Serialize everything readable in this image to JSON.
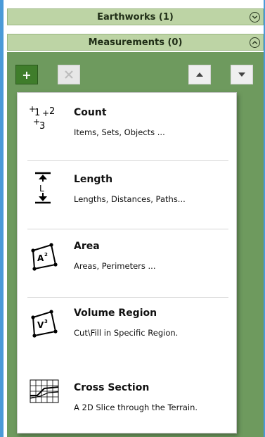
{
  "sections": {
    "earthworks": {
      "label": "Earthworks (1)",
      "state": "collapsed"
    },
    "measurements": {
      "label": "Measurements (0)",
      "state": "expanded"
    }
  },
  "toolbar": {
    "add_label": "+",
    "delete_icon": "close-icon",
    "up_icon": "arrow-up-icon",
    "down_icon": "arrow-down-icon"
  },
  "menu": {
    "items": [
      {
        "title": "Count",
        "desc": "Items, Sets, Objects ...",
        "icon": "count-icon",
        "glyphs": {
          "a": "+",
          "a_sub": "1",
          "b": "+",
          "b_sub": "2",
          "c": "+",
          "c_sub": "3"
        }
      },
      {
        "title": "Length",
        "desc": "Lengths, Distances, Paths...",
        "icon": "length-icon",
        "glyph": "L"
      },
      {
        "title": "Area",
        "desc": "Areas, Perimeters ...",
        "icon": "area-icon",
        "glyph": "A",
        "glyph_sup": "2"
      },
      {
        "title": "Volume Region",
        "desc": "Cut\\Fill in Specific Region.",
        "icon": "volume-icon",
        "glyph": "V",
        "glyph_sup": "3"
      },
      {
        "title": "Cross Section",
        "desc": "A 2D Slice through the Terrain.",
        "icon": "cross-section-icon"
      }
    ]
  },
  "colors": {
    "header_bg": "#bdd4a5",
    "panel_bg": "#6e9a5e",
    "add_button": "#3f7d2b",
    "frame_accent": "#4a9ad8"
  }
}
